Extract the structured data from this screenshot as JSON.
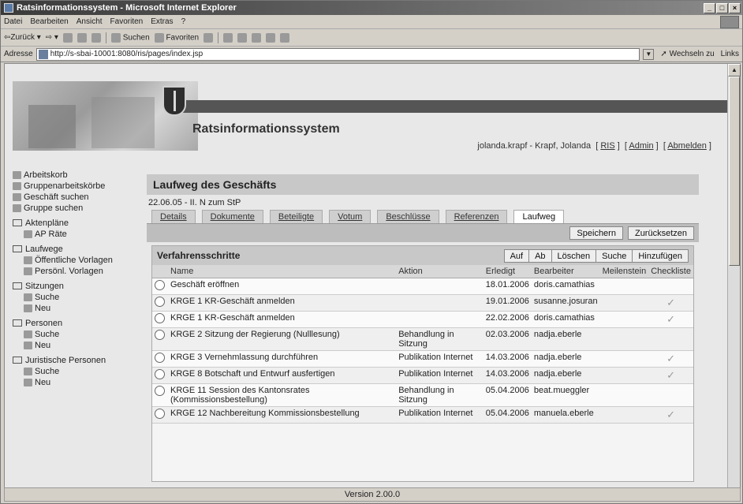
{
  "window": {
    "title": "Ratsinformationssystem - Microsoft Internet Explorer"
  },
  "menubar": {
    "items": [
      "Datei",
      "Bearbeiten",
      "Ansicht",
      "Favoriten",
      "Extras",
      "?"
    ]
  },
  "toolbar": {
    "back": "Zurück",
    "search": "Suchen",
    "favorites": "Favoriten"
  },
  "address": {
    "label": "Adresse",
    "url": "http://s-sbai-10001:8080/ris/pages/index.jsp",
    "go": "Wechseln zu",
    "links": "Links"
  },
  "header": {
    "app_title": "Ratsinformationssystem",
    "user": "jolanda.krapf - Krapf, Jolanda",
    "links": [
      "RIS",
      "Admin",
      "Abmelden"
    ]
  },
  "nav": {
    "top": [
      "Arbeitskorb",
      "Gruppenarbeitskörbe",
      "Geschäft suchen",
      "Gruppe suchen"
    ],
    "groups": [
      {
        "title": "Aktenpläne",
        "items": [
          "AP Räte"
        ]
      },
      {
        "title": "Laufwege",
        "items": [
          "Öffentliche Vorlagen",
          "Persönl. Vorlagen"
        ]
      },
      {
        "title": "Sitzungen",
        "items": [
          "Suche",
          "Neu"
        ]
      },
      {
        "title": "Personen",
        "items": [
          "Suche",
          "Neu"
        ]
      },
      {
        "title": "Juristische Personen",
        "items": [
          "Suche",
          "Neu"
        ]
      }
    ]
  },
  "main": {
    "title": "Laufweg des Geschäfts",
    "subtitle": "22.06.05 - II. N zum StP",
    "tabs": [
      "Details",
      "Dokumente",
      "Beteiligte",
      "Votum",
      "Beschlüsse",
      "Referenzen",
      "Laufweg"
    ],
    "save": "Speichern",
    "reset": "Zurücksetzen"
  },
  "steps": {
    "title": "Verfahrensschritte",
    "buttons": [
      "Auf",
      "Ab",
      "Löschen",
      "Suche",
      "Hinzufügen"
    ],
    "columns": [
      "Name",
      "Aktion",
      "Erledigt",
      "Bearbeiter",
      "Meilenstein",
      "Checkliste"
    ],
    "rows": [
      {
        "name": "Geschäft eröffnen",
        "action": "",
        "done": "18.01.2006",
        "user": "doris.camathias",
        "check": ""
      },
      {
        "name": "KRGE 1 KR-Geschäft anmelden",
        "action": "",
        "done": "19.01.2006",
        "user": "susanne.josuran",
        "check": "✓"
      },
      {
        "name": "KRGE 1 KR-Geschäft anmelden",
        "action": "",
        "done": "22.02.2006",
        "user": "doris.camathias",
        "check": "✓"
      },
      {
        "name": "KRGE 2 Sitzung der Regierung (Nulllesung)",
        "action": "Behandlung in Sitzung",
        "done": "02.03.2006",
        "user": "nadja.eberle",
        "check": ""
      },
      {
        "name": "KRGE 3 Vernehmlassung durchführen",
        "action": "Publikation Internet",
        "done": "14.03.2006",
        "user": "nadja.eberle",
        "check": "✓"
      },
      {
        "name": "KRGE 8 Botschaft und Entwurf ausfertigen",
        "action": "Publikation Internet",
        "done": "14.03.2006",
        "user": "nadja.eberle",
        "check": "✓"
      },
      {
        "name": "KRGE 11 Session des Kantonsrates (Kommissionsbestellung)",
        "action": "Behandlung in Sitzung",
        "done": "05.04.2006",
        "user": "beat.mueggler",
        "check": ""
      },
      {
        "name": "KRGE 12 Nachbereitung Kommissionsbestellung",
        "action": "Publikation Internet",
        "done": "05.04.2006",
        "user": "manuela.eberle",
        "check": "✓"
      }
    ]
  },
  "footer": {
    "version": "Version 2.00.0"
  }
}
